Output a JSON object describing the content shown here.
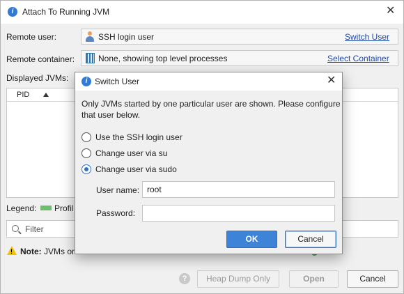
{
  "main_window": {
    "title": "Attach To Running JVM",
    "remote_user_label": "Remote user:",
    "remote_user_value": "SSH login user",
    "switch_user_link": "Switch User",
    "remote_container_label": "Remote container:",
    "remote_container_value": "None, showing top level processes",
    "select_container_link": "Select Container",
    "displayed_jvms_label": "Displayed JVMs:",
    "table": {
      "columns": [
        "PID"
      ]
    },
    "legend_label": "Legend:",
    "legend_item": "Profil",
    "filter_placeholder": "Filter",
    "note_bold": "Note:",
    "note_text": "JVMs on",
    "buttons": {
      "heap_dump_only": "Heap Dump Only",
      "open": "Open",
      "cancel": "Cancel"
    }
  },
  "dialog": {
    "title": "Switch User",
    "description_line1": "Only JVMs started by one particular user are shown. Please configure",
    "description_line2": "that user below.",
    "options": [
      {
        "label": "Use the SSH login user",
        "selected": false
      },
      {
        "label": "Change user via su",
        "selected": false
      },
      {
        "label": "Change user via sudo",
        "selected": true
      }
    ],
    "user_name_label": "User name:",
    "user_name_value": "root",
    "password_label": "Password:",
    "password_value": "",
    "ok_label": "OK",
    "cancel_label": "Cancel"
  },
  "colors": {
    "accent": "#3d84d8",
    "link": "#1f4aa6",
    "legend_profiled": "#6bbf6b",
    "warning": "#f2c200"
  }
}
